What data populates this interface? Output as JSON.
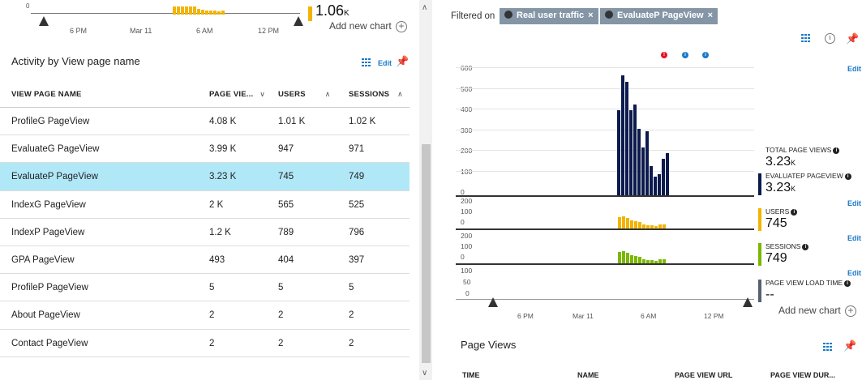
{
  "left": {
    "mini_chart": {
      "zero_label": "0",
      "ticks": [
        "6 PM",
        "Mar 11",
        "6 AM",
        "12 PM"
      ],
      "bars": [
        1,
        1,
        1,
        1,
        1,
        1,
        0.65,
        0.55,
        0.5,
        0.45,
        0.5,
        0.4,
        0.45
      ],
      "value": "1.06",
      "unit": "K",
      "add_new_chart": "Add new chart"
    },
    "activity_title": "Activity by View page name",
    "edit": "Edit",
    "columns": [
      "VIEW PAGE NAME",
      "PAGE VIE...",
      "USERS",
      "SESSIONS"
    ],
    "rows": [
      {
        "name": "ProfileG PageView",
        "views": "4.08 K",
        "users": "1.01 K",
        "sessions": "1.02 K"
      },
      {
        "name": "EvaluateG PageView",
        "views": "3.99 K",
        "users": "947",
        "sessions": "971"
      },
      {
        "name": "EvaluateP PageView",
        "views": "3.23 K",
        "users": "745",
        "sessions": "749"
      },
      {
        "name": "IndexG PageView",
        "views": "2 K",
        "users": "565",
        "sessions": "525"
      },
      {
        "name": "IndexP PageView",
        "views": "1.2 K",
        "users": "789",
        "sessions": "796"
      },
      {
        "name": "GPA PageView",
        "views": "493",
        "users": "404",
        "sessions": "397"
      },
      {
        "name": "ProfileP PageView",
        "views": "5",
        "users": "5",
        "sessions": "5"
      },
      {
        "name": "About PageView",
        "views": "2",
        "users": "2",
        "sessions": "2"
      },
      {
        "name": "Contact PageView",
        "views": "2",
        "users": "2",
        "sessions": "2"
      }
    ]
  },
  "right": {
    "filtered_on": "Filtered on",
    "filters": [
      "Real user traffic",
      "EvaluateP PageView"
    ],
    "edit": "Edit",
    "y_labels_main": [
      "600",
      "500",
      "400",
      "300",
      "200",
      "100",
      "0"
    ],
    "y_labels_users": [
      "200",
      "100",
      "0"
    ],
    "y_labels_sessions": [
      "200",
      "100",
      "0"
    ],
    "y_labels_load": [
      "100",
      "50",
      "0"
    ],
    "x_ticks": [
      "6 PM",
      "Mar 11",
      "6 AM",
      "12 PM"
    ],
    "metrics": [
      {
        "label": "TOTAL PAGE VIEWS",
        "value": "3.23",
        "unit": "K",
        "color": ""
      },
      {
        "label": "EVALUATEP PAGEVIEW",
        "value": "3.23",
        "unit": "K",
        "color": "#0c1a4d"
      },
      {
        "label": "USERS",
        "value": "745",
        "unit": "",
        "color": "#f2b400"
      },
      {
        "label": "SESSIONS",
        "value": "749",
        "unit": "",
        "color": "#7ab800"
      },
      {
        "label": "PAGE VIEW LOAD TIME",
        "value": "--",
        "unit": "",
        "color": "#556270"
      }
    ],
    "add_new_chart": "Add new chart",
    "page_views_title": "Page Views",
    "page_views_columns": [
      "TIME",
      "NAME",
      "PAGE VIEW URL",
      "PAGE VIEW DUR..."
    ]
  },
  "chart_data": {
    "type": "bar",
    "x": [
      "6 PM",
      "Mar 11",
      "6 AM",
      "12 PM"
    ],
    "series": [
      {
        "name": "EVALUATEP PAGEVIEW",
        "color": "#0c1a4d",
        "values": [
          410,
          580,
          550,
          410,
          440,
          320,
          230,
          310,
          140,
          90,
          100,
          175,
          205
        ]
      },
      {
        "name": "USERS",
        "color": "#f2b400",
        "values": [
          105,
          115,
          100,
          80,
          70,
          60,
          40,
          30,
          30,
          25,
          35,
          35
        ]
      },
      {
        "name": "SESSIONS",
        "color": "#7ab800",
        "values": [
          105,
          115,
          100,
          80,
          70,
          60,
          40,
          30,
          30,
          25,
          35,
          35
        ]
      }
    ]
  }
}
